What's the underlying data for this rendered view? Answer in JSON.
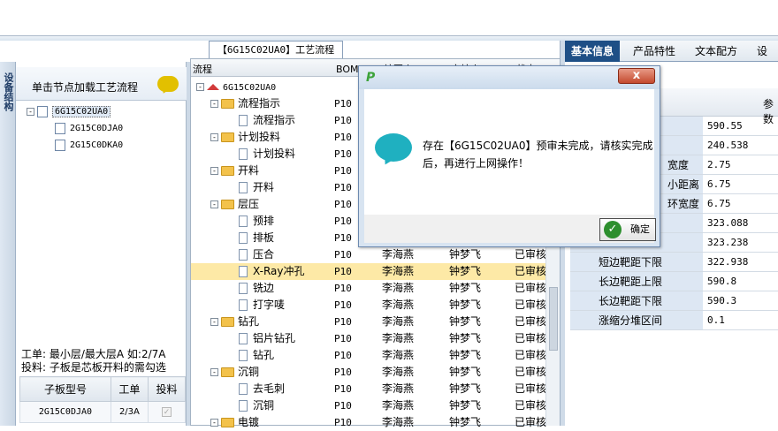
{
  "left_panel": {
    "vertical_tab": "设备结构",
    "header_text": "单击节点加载工艺流程",
    "tree": [
      {
        "label": "6G15C02UA0",
        "toggle": "-",
        "selected": true,
        "level": 0
      },
      {
        "label": "2G15C0DJA0",
        "level": 1
      },
      {
        "label": "2G15C0DKA0",
        "level": 1
      }
    ],
    "info_line1": "工单: 最小层/最大层A 如:2/7A",
    "info_line2": "投料: 子板是芯板开料的需勾选",
    "table": {
      "headers": [
        "子板型号",
        "工单",
        "投料"
      ],
      "rows": [
        {
          "model": "2G15C0DJA0",
          "order": "2/3A",
          "checked": true
        }
      ]
    }
  },
  "center_panel": {
    "tab_title": "【6G15C02UA0】工艺流程",
    "headers": [
      "流程",
      "BOM工",
      "编写人",
      "审核人",
      "状态"
    ],
    "rows": [
      {
        "name": "6G15C02UA0",
        "kind": "root",
        "toggle": "-",
        "level": 0,
        "bom": "",
        "author": "",
        "reviewer": "",
        "status": ""
      },
      {
        "name": "流程指示",
        "kind": "folder",
        "toggle": "-",
        "level": 1,
        "bom": "P10",
        "author": "",
        "reviewer": "",
        "status": ""
      },
      {
        "name": "流程指示",
        "kind": "doc",
        "level": 2,
        "bom": "P10",
        "author": "",
        "reviewer": "",
        "status": ""
      },
      {
        "name": "计划投料",
        "kind": "folder",
        "toggle": "-",
        "level": 1,
        "bom": "P10",
        "author": "",
        "reviewer": "",
        "status": ""
      },
      {
        "name": "计划投料",
        "kind": "doc",
        "level": 2,
        "bom": "P10",
        "author": "",
        "reviewer": "",
        "status": ""
      },
      {
        "name": "开料",
        "kind": "folder",
        "toggle": "-",
        "level": 1,
        "bom": "P10",
        "author": "",
        "reviewer": "",
        "status": ""
      },
      {
        "name": "开料",
        "kind": "doc",
        "level": 2,
        "bom": "P10",
        "author": "",
        "reviewer": "",
        "status": ""
      },
      {
        "name": "层压",
        "kind": "folder",
        "toggle": "-",
        "level": 1,
        "bom": "P10",
        "author": "",
        "reviewer": "",
        "status": ""
      },
      {
        "name": "预排",
        "kind": "doc",
        "level": 2,
        "bom": "P10",
        "author": "",
        "reviewer": "",
        "status": ""
      },
      {
        "name": "排板",
        "kind": "doc",
        "level": 2,
        "bom": "P10",
        "author": "",
        "reviewer": "",
        "status": ""
      },
      {
        "name": "压合",
        "kind": "doc",
        "level": 2,
        "bom": "P10",
        "author": "李海燕",
        "reviewer": "钟梦飞",
        "status": "已审核"
      },
      {
        "name": "X-Ray冲孔",
        "kind": "doc",
        "level": 2,
        "bom": "P10",
        "author": "李海燕",
        "reviewer": "钟梦飞",
        "status": "已审核",
        "highlight": true
      },
      {
        "name": "铣边",
        "kind": "doc",
        "level": 2,
        "bom": "P10",
        "author": "李海燕",
        "reviewer": "钟梦飞",
        "status": "已审核"
      },
      {
        "name": "打字唛",
        "kind": "doc",
        "level": 2,
        "bom": "P10",
        "author": "李海燕",
        "reviewer": "钟梦飞",
        "status": "已审核"
      },
      {
        "name": "钻孔",
        "kind": "folder",
        "toggle": "-",
        "level": 1,
        "bom": "P10",
        "author": "李海燕",
        "reviewer": "钟梦飞",
        "status": "已审核"
      },
      {
        "name": "铝片钻孔",
        "kind": "doc",
        "level": 2,
        "bom": "P10",
        "author": "李海燕",
        "reviewer": "钟梦飞",
        "status": "已审核"
      },
      {
        "name": "钻孔",
        "kind": "doc",
        "level": 2,
        "bom": "P10",
        "author": "李海燕",
        "reviewer": "钟梦飞",
        "status": "已审核"
      },
      {
        "name": "沉铜",
        "kind": "folder",
        "toggle": "-",
        "level": 1,
        "bom": "P10",
        "author": "李海燕",
        "reviewer": "钟梦飞",
        "status": "已审核"
      },
      {
        "name": "去毛刺",
        "kind": "doc",
        "level": 2,
        "bom": "P10",
        "author": "李海燕",
        "reviewer": "钟梦飞",
        "status": "已审核"
      },
      {
        "name": "沉铜",
        "kind": "doc",
        "level": 2,
        "bom": "P10",
        "author": "李海燕",
        "reviewer": "钟梦飞",
        "status": "已审核"
      },
      {
        "name": "电镀",
        "kind": "folder",
        "toggle": "-",
        "level": 1,
        "bom": "P10",
        "author": "李海燕",
        "reviewer": "钟梦飞",
        "status": "已审核"
      }
    ]
  },
  "right_panel": {
    "tabs": [
      {
        "label": "基本信息",
        "active": true
      },
      {
        "label": "产品特性",
        "active": false
      },
      {
        "label": "文本配方",
        "active": false
      },
      {
        "label": "设备",
        "active": false
      }
    ],
    "header": "参数",
    "rows": [
      {
        "label": "",
        "value": "590.55"
      },
      {
        "label": "",
        "value": "240.538"
      },
      {
        "label": "宽度",
        "value": "2.75"
      },
      {
        "label": "小距离",
        "value": "6.75"
      },
      {
        "label": "环宽度",
        "value": "6.75"
      },
      {
        "label": "",
        "value": "323.088"
      },
      {
        "label": "",
        "value": "323.238"
      },
      {
        "label": "短边靶距下限",
        "value": "322.938"
      },
      {
        "label": "长边靶距上限",
        "value": "590.8"
      },
      {
        "label": "长边靶距下限",
        "value": "590.3"
      },
      {
        "label": "涨缩分堆区间",
        "value": "0.1"
      }
    ]
  },
  "dialog": {
    "close_label": "x",
    "message": "存在【6G15C02UA0】预审未完成，请核实完成后，再进行上网操作！",
    "ok_label": "确定"
  },
  "colors": {
    "accent": "#1e4f86",
    "highlight": "#fde9a6",
    "bubble_yellow": "#e2c000",
    "bubble_teal": "#1fb0c0"
  }
}
